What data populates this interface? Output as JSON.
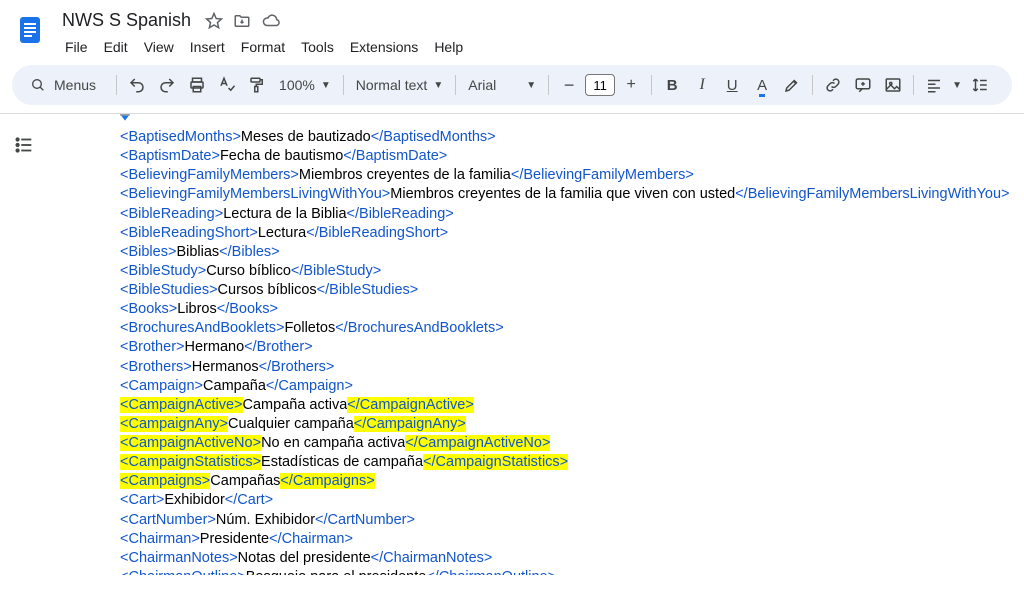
{
  "header": {
    "title": "NWS S Spanish",
    "menus_label": "Menus",
    "menu": [
      "File",
      "Edit",
      "View",
      "Insert",
      "Format",
      "Tools",
      "Extensions",
      "Help"
    ]
  },
  "toolbar": {
    "zoom": "100%",
    "style": "Normal text",
    "font": "Arial",
    "font_size": "11"
  },
  "doc_lines": [
    {
      "open": "BaptisedMonths",
      "text": "Meses de bautizado",
      "close": "BaptisedMonths",
      "hl": false
    },
    {
      "open": "BaptismDate",
      "text": "Fecha de bautismo",
      "close": "BaptismDate",
      "hl": false
    },
    {
      "open": "BelievingFamilyMembers",
      "text": "Miembros creyentes de la familia",
      "close": "BelievingFamilyMembers",
      "hl": false
    },
    {
      "open": "BelievingFamilyMembersLivingWithYou",
      "text": "Miembros creyentes de la familia que viven con usted",
      "close": "BelievingFamilyMembersLivingWithYou",
      "hl": false
    },
    {
      "open": "BibleReading",
      "text": "Lectura de la Biblia",
      "close": "BibleReading",
      "hl": false
    },
    {
      "open": "BibleReadingShort",
      "text": "Lectura",
      "close": "BibleReadingShort",
      "hl": false
    },
    {
      "open": "Bibles",
      "text": "Biblias",
      "close": "Bibles",
      "hl": false
    },
    {
      "open": "BibleStudy",
      "text": "Curso bíblico",
      "close": "BibleStudy",
      "hl": false
    },
    {
      "open": "BibleStudies",
      "text": "Cursos bíblicos",
      "close": "BibleStudies",
      "hl": false
    },
    {
      "open": "Books",
      "text": "Libros",
      "close": "Books",
      "hl": false
    },
    {
      "open": "BrochuresAndBooklets",
      "text": "Folletos",
      "close": "BrochuresAndBooklets",
      "hl": false
    },
    {
      "open": "Brother",
      "text": "Hermano",
      "close": "Brother",
      "hl": false
    },
    {
      "open": "Brothers",
      "text": "Hermanos",
      "close": "Brothers",
      "hl": false
    },
    {
      "open": "Campaign",
      "text": "Campaña",
      "close": "Campaign",
      "hl": false
    },
    {
      "open": "CampaignActive",
      "text": "Campaña activa",
      "close": "CampaignActive",
      "hl": true
    },
    {
      "open": "CampaignAny",
      "text": "Cualquier campaña",
      "close": "CampaignAny",
      "hl": true
    },
    {
      "open": "CampaignActiveNo",
      "text": "No en campaña activa",
      "close": "CampaignActiveNo",
      "hl": true
    },
    {
      "open": "CampaignStatistics",
      "text": "Estadísticas de campaña",
      "close": "CampaignStatistics",
      "hl": true
    },
    {
      "open": "Campaigns",
      "text": "Campañas",
      "close": "Campaigns",
      "hl": true
    },
    {
      "open": "Cart",
      "text": "Exhibidor",
      "close": "Cart",
      "hl": false
    },
    {
      "open": "CartNumber",
      "text": "Núm. Exhibidor",
      "close": "CartNumber",
      "hl": false
    },
    {
      "open": "Chairman",
      "text": "Presidente",
      "close": "Chairman",
      "hl": false
    },
    {
      "open": "ChairmanNotes",
      "text": "Notas del presidente",
      "close": "ChairmanNotes",
      "hl": false
    },
    {
      "open": "ChairmanOutline",
      "text": "Bosquejo para el presidente",
      "close": "ChairmanOutline",
      "hl": false
    }
  ]
}
